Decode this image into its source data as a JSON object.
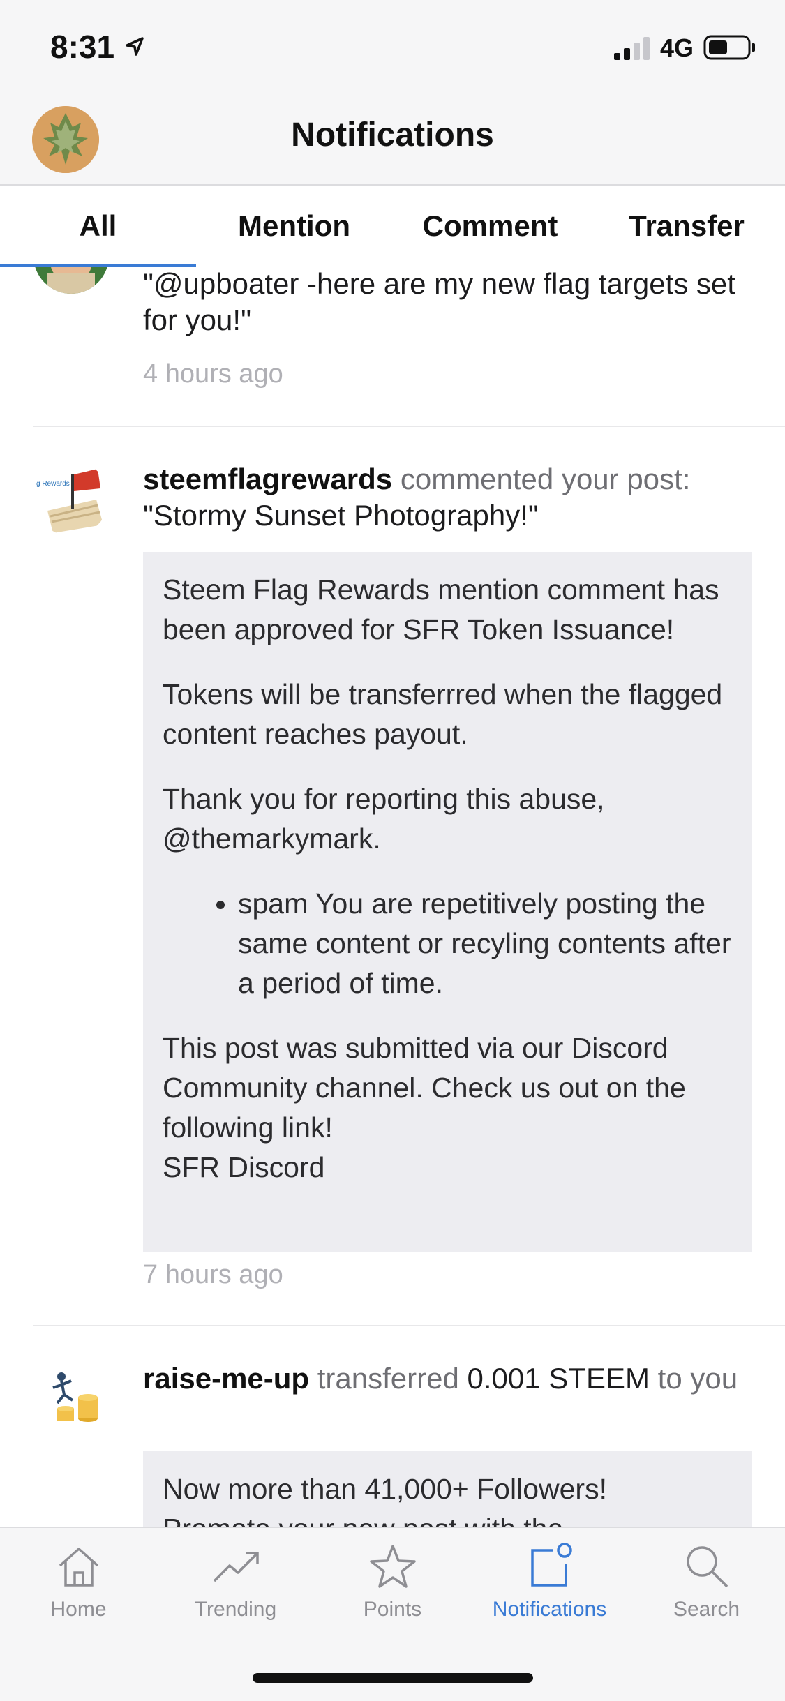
{
  "status_bar": {
    "time": "8:31",
    "network": "4G"
  },
  "header": {
    "title": "Notifications"
  },
  "tabs": [
    {
      "label": "All",
      "active": true
    },
    {
      "label": "Mention",
      "active": false
    },
    {
      "label": "Comment",
      "active": false
    },
    {
      "label": "Transfer",
      "active": false
    }
  ],
  "notifications": [
    {
      "message": "\"@upboater -here are my new flag targets set for you!\"",
      "time": "4 hours ago"
    },
    {
      "user": "steemflagrewards",
      "action": "commented your post:",
      "subject": "\"Stormy Sunset Photography!\"",
      "body": {
        "p1": "Steem Flag Rewards mention comment has been approved for SFR Token Issuance!",
        "p2": "Tokens will be transferrred when the flagged content reaches payout.",
        "p3": "Thank you for reporting this abuse, @themarkymark.",
        "bullet": "spam You are repetitively posting the same content or recyling contents after a period of time.",
        "p4": "This post was submitted via our Discord Community channel. Check us out on the following link!",
        "link": "SFR Discord"
      },
      "time": "7 hours ago"
    },
    {
      "user": "raise-me-up",
      "action": "transferred",
      "amount": "0.001 STEEM",
      "suffix": "to you",
      "memo_line1": "Now more than 41,000+ Followers!",
      "memo_line2": "Promote your new post with the"
    }
  ],
  "bottom_nav": [
    {
      "label": "Home",
      "icon": "home-icon"
    },
    {
      "label": "Trending",
      "icon": "trending-icon"
    },
    {
      "label": "Points",
      "icon": "star-icon"
    },
    {
      "label": "Notifications",
      "icon": "notifications-icon",
      "active": true
    },
    {
      "label": "Search",
      "icon": "search-icon"
    }
  ],
  "colors": {
    "accent": "#3a7bd5",
    "muted": "#8e8e93",
    "card_bg": "#ededf1"
  }
}
